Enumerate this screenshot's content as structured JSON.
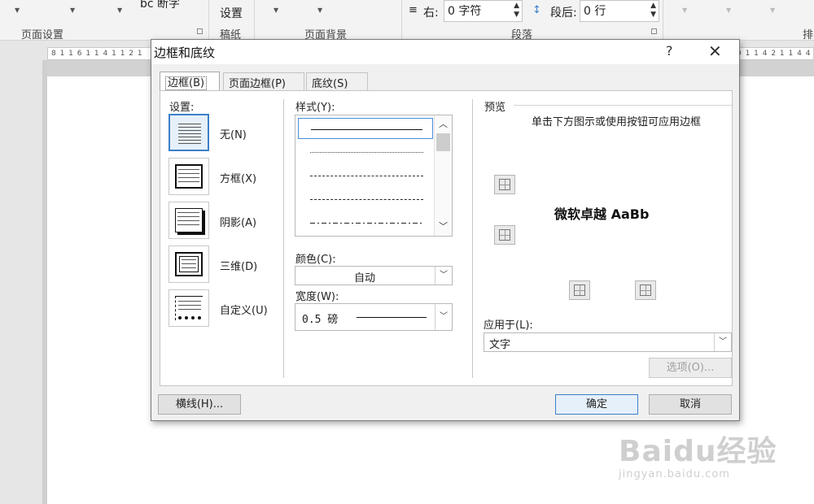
{
  "ribbon": {
    "groups": [
      "页面设置",
      "稿纸",
      "页面背景",
      "段落",
      "排"
    ],
    "partial_top": [
      "bc 断字",
      "设置"
    ],
    "right_label": "右:",
    "right_value": "0 字符",
    "after_label": "段后:",
    "after_value": "0 行"
  },
  "ruler": {
    "left_text": "8 1  1 6 1  1 4 1  1 2 1",
    "right_text": "0 1  1 4 2 1  1 4 4 1"
  },
  "dialog": {
    "title": "边框和底纹",
    "help": "?",
    "close": "✕",
    "tabs": [
      "边框(B)",
      "页面边框(P)",
      "底纹(S)"
    ],
    "settings_label": "设置:",
    "settings": [
      {
        "label": "无(N)",
        "icon": "border-none-icon"
      },
      {
        "label": "方框(X)",
        "icon": "border-box-icon"
      },
      {
        "label": "阴影(A)",
        "icon": "border-shadow-icon"
      },
      {
        "label": "三维(D)",
        "icon": "border-3d-icon"
      },
      {
        "label": "自定义(U)",
        "icon": "border-custom-icon"
      }
    ],
    "style_label": "样式(Y):",
    "color_label": "颜色(C):",
    "color_value": "自动",
    "width_label": "宽度(W):",
    "width_value": "0.5 磅",
    "preview_label": "预览",
    "preview_hint": "单击下方图示或使用按钮可应用边框",
    "preview_sample": "微软卓越  AaBb",
    "apply_label": "应用于(L):",
    "apply_value": "文字",
    "options_button": "选项(O)...",
    "horizontal_line_button": "横线(H)...",
    "ok_button": "确定",
    "cancel_button": "取消"
  },
  "watermark": {
    "text": "Baidu经验",
    "url": "jingyan.baidu.com"
  }
}
